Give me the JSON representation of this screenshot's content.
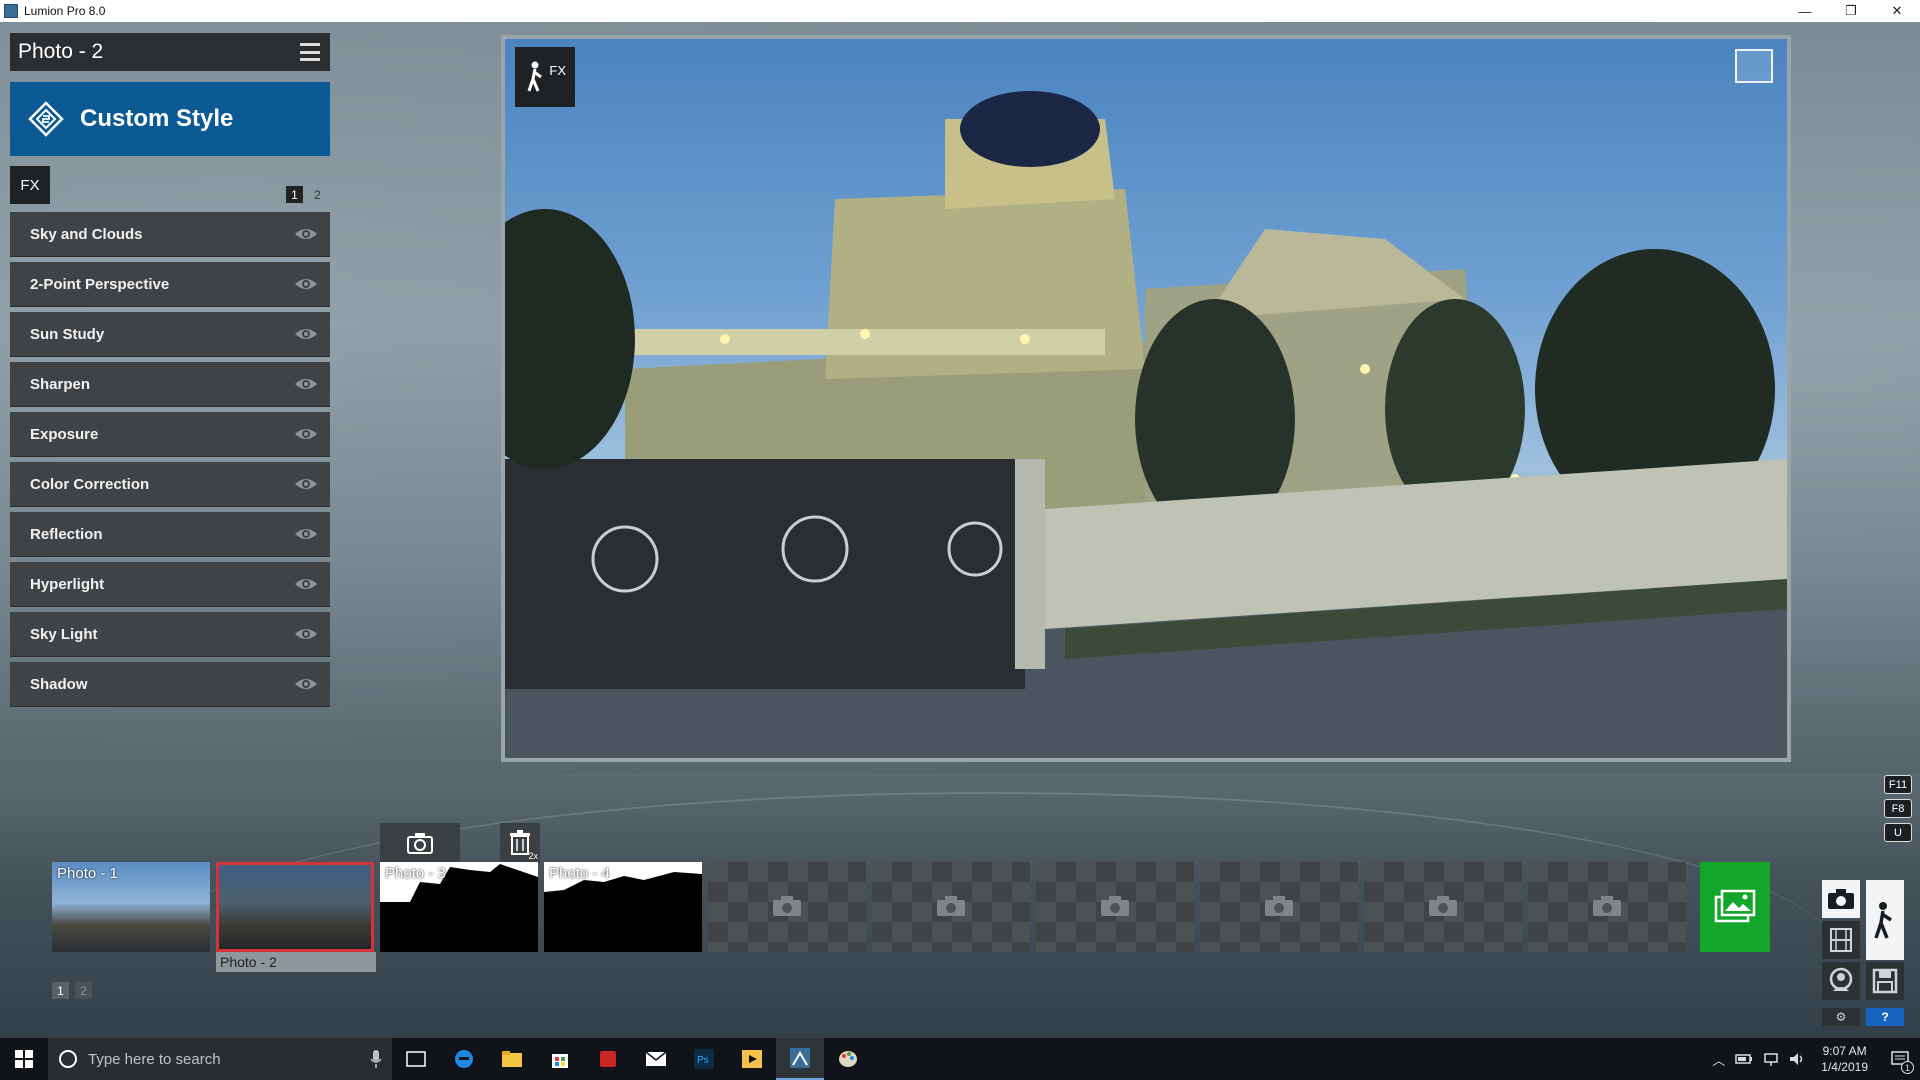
{
  "window": {
    "title": "Lumion Pro 8.0",
    "controls": [
      "—",
      "❐",
      "✕"
    ]
  },
  "left_panel": {
    "photo_name": "Photo - 2",
    "style_name": "Custom Style",
    "fx_tag": "FX",
    "pages": [
      "1",
      "2"
    ],
    "active_page": "1",
    "effects": [
      "Sky and Clouds",
      "2-Point Perspective",
      "Sun Study",
      "Sharpen",
      "Exposure",
      "Color Correction",
      "Reflection",
      "Hyperlight",
      "Sky Light",
      "Shadow"
    ]
  },
  "viewport": {
    "badge": "FX"
  },
  "hotkeys": [
    "F11",
    "F8",
    "U"
  ],
  "filmstrip": {
    "slots": [
      {
        "label": "Photo - 1",
        "kind": "photo"
      },
      {
        "label": "",
        "kind": "photo-selected"
      },
      {
        "label": "Photo - 3",
        "kind": "silhouette"
      },
      {
        "label": "Photo - 4",
        "kind": "silhouette"
      },
      {
        "label": "",
        "kind": "empty"
      },
      {
        "label": "",
        "kind": "empty"
      },
      {
        "label": "",
        "kind": "empty"
      },
      {
        "label": "",
        "kind": "empty"
      },
      {
        "label": "",
        "kind": "empty"
      },
      {
        "label": "",
        "kind": "empty"
      }
    ],
    "selected_caption": "Photo - 2",
    "delete_badge": "2x",
    "pages": [
      "1",
      "2"
    ],
    "active_page": "1"
  },
  "right_controls": {
    "help": "?",
    "settings": "⚙"
  },
  "taskbar": {
    "search_placeholder": "Type here to search",
    "time": "9:07 AM",
    "date": "1/4/2019",
    "notification_count": "1"
  },
  "colors": {
    "accent_blue": "#0c5a94",
    "render_green": "#14a52b",
    "selection_red": "#d3343a",
    "panel_dark": "#3f4346"
  }
}
